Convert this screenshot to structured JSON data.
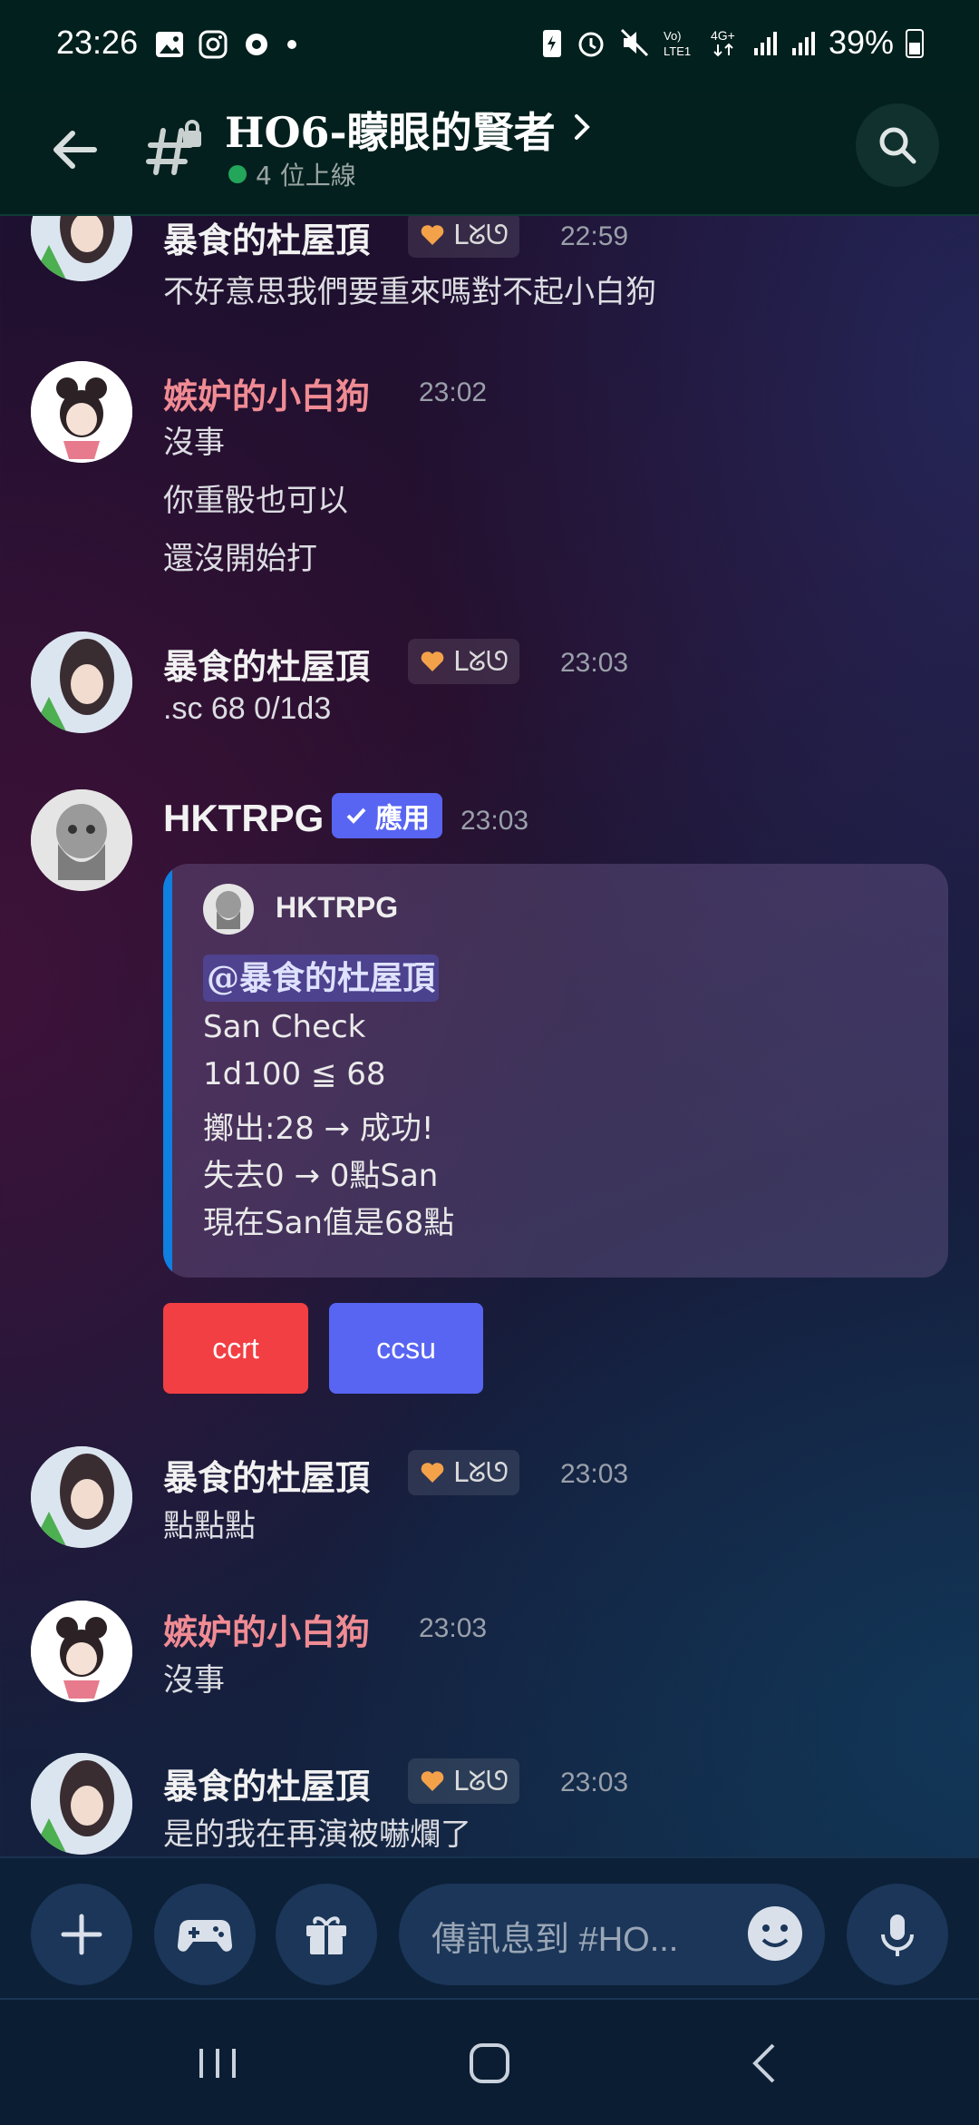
{
  "status_bar": {
    "time": "23:26",
    "battery": "39%"
  },
  "header": {
    "channel_title": "HO6-矇眼的賢者",
    "online": "4 位上線"
  },
  "messages": [
    {
      "user": "暴食的杜屋頂",
      "tag": "ᒪᘜᘎ",
      "time": "22:59",
      "lines": [
        "不好意思我們要重來嗎對不起小白狗"
      ]
    },
    {
      "user": "嫉妒的小白狗",
      "time": "23:02",
      "lines": [
        "沒事",
        "你重骰也可以",
        "還沒開始打"
      ]
    },
    {
      "user": "暴食的杜屋頂",
      "tag": "ᒪᘜᘎ",
      "time": "23:03",
      "lines": [
        ".sc 68 0/1d3"
      ]
    },
    {
      "user": "HKTRPG",
      "badge": "應用",
      "time": "23:03"
    },
    {
      "user": "暴食的杜屋頂",
      "tag": "ᒪᘜᘎ",
      "time": "23:03",
      "lines": [
        "點點點"
      ]
    },
    {
      "user": "嫉妒的小白狗",
      "time": "23:03",
      "lines": [
        "沒事"
      ]
    },
    {
      "user": "暴食的杜屋頂",
      "tag": "ᒪᘜᘎ",
      "time": "23:03",
      "lines": [
        "是的我在再演被嚇爛了"
      ]
    }
  ],
  "embed": {
    "author": "HKTRPG",
    "mention": "@暴食的杜屋頂",
    "lines": [
      "San Check",
      "1d100 ≦ 68",
      "擲出:28 → 成功!",
      "失去0 → 0點San",
      "現在San值是68點"
    ]
  },
  "buttons": {
    "ccrt": "ccrt",
    "ccsu": "ccsu"
  },
  "composer": {
    "placeholder": "傳訊息到 #HO..."
  },
  "colors": {
    "accent": "#5865f2",
    "danger": "#f23f43",
    "pink_name": "#f08b93",
    "online": "#23a55a"
  }
}
